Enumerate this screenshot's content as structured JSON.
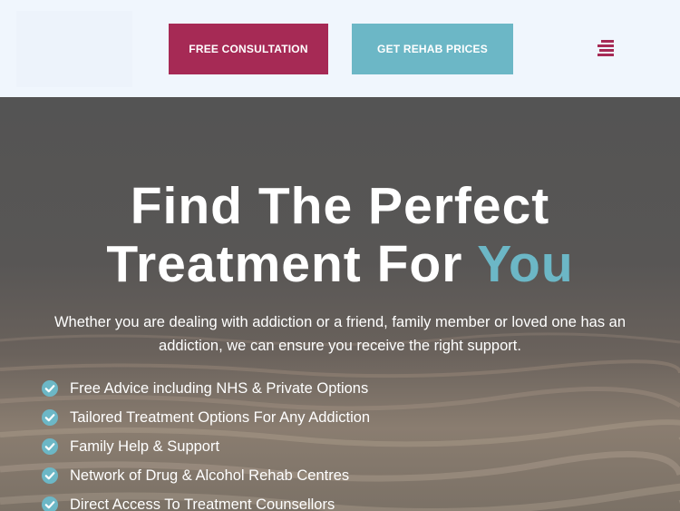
{
  "header": {
    "consultation_label": "FREE CONSULTATION",
    "prices_label": "GET REHAB PRICES",
    "menu_icon": "hamburger-menu-icon"
  },
  "hero": {
    "title_line1": "Find The Perfect",
    "title_line2": "Treatment For ",
    "title_accent": "You",
    "intro": "Whether you are dealing with addiction or a friend, family member or loved one has an addiction, we can ensure you receive the right support.",
    "features": [
      "Free Advice including NHS & Private Options",
      "Tailored Treatment Options For Any Addiction",
      "Family Help & Support",
      "Network of Drug & Alcohol Rehab Centres",
      "Direct Access To Treatment Counsellors"
    ],
    "check_icon": "check-circle-icon"
  },
  "colors": {
    "brand_primary": "#a62a55",
    "brand_accent": "#6cb7c6",
    "header_bg": "#f0f6fd"
  }
}
